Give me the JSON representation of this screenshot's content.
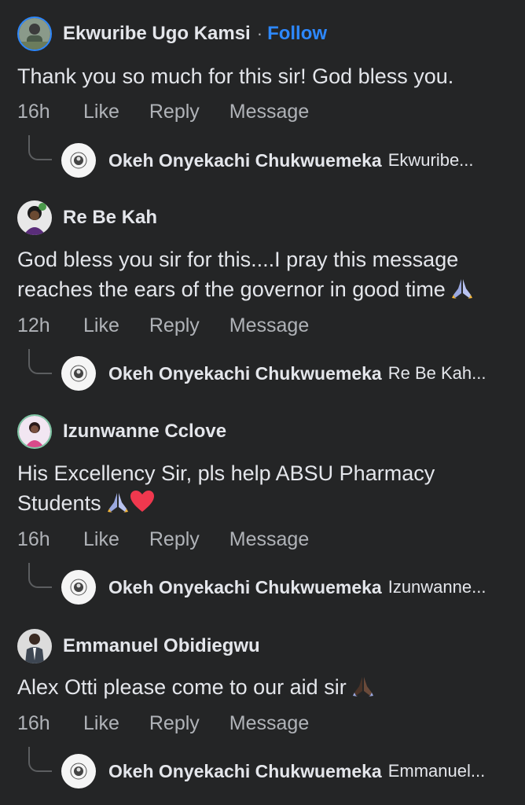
{
  "comments": [
    {
      "author": "Ekwuribe Ugo Kamsi",
      "follow_separator": "·",
      "follow_label": "Follow",
      "text": "Thank you so much for this sir! God bless you.",
      "time": "16h",
      "like_label": "Like",
      "reply_label": "Reply",
      "message_label": "Message",
      "reply": {
        "author": "Okeh Onyekachi Chukwuemeka",
        "preview": "Ekwuribe..."
      }
    },
    {
      "author": "Re Be Kah",
      "text_lines": [
        "God bless you sir for this....I pray this message",
        "reaches the ears of the governor in good time"
      ],
      "emojis": [
        "folded-hands-emoji"
      ],
      "time": "12h",
      "like_label": "Like",
      "reply_label": "Reply",
      "message_label": "Message",
      "reply": {
        "author": "Okeh Onyekachi Chukwuemeka",
        "preview": "Re Be Kah..."
      }
    },
    {
      "author": "Izunwanne Cclove",
      "text_lines": [
        "His Excellency Sir, pls help ABSU Pharmacy",
        "Students"
      ],
      "emojis": [
        "folded-hands-emoji",
        "red-heart-emoji"
      ],
      "time": "16h",
      "like_label": "Like",
      "reply_label": "Reply",
      "message_label": "Message",
      "reply": {
        "author": "Okeh Onyekachi Chukwuemeka",
        "preview": "Izunwanne..."
      }
    },
    {
      "author": "Emmanuel Obidiegwu",
      "text": "Alex Otti please come to our aid sir",
      "emojis": [
        "folded-hands-dark-emoji"
      ],
      "time": "16h",
      "like_label": "Like",
      "reply_label": "Reply",
      "message_label": "Message",
      "reply": {
        "author": "Okeh Onyekachi Chukwuemeka",
        "preview": "Emmanuel..."
      }
    }
  ],
  "colors": {
    "background": "#242526",
    "primary_text": "#e4e6eb",
    "secondary_text": "#b0b3b8",
    "link_blue": "#2d88ff",
    "connector": "#5c5e60"
  }
}
